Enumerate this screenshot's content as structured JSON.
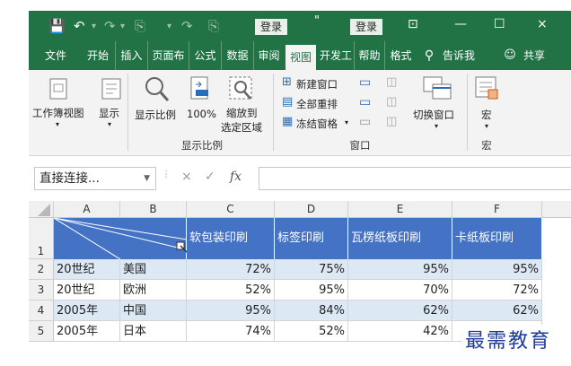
{
  "titlebar": {
    "login_1": "登录",
    "login_2": "登录",
    "title_mark": "\"",
    "minimize": "—",
    "restore": "☐",
    "close": "×"
  },
  "tabs": [
    {
      "label": "文件"
    },
    {
      "label": "开始"
    },
    {
      "label": "插入"
    },
    {
      "label": "页面布"
    },
    {
      "label": "公式"
    },
    {
      "label": "数据"
    },
    {
      "label": "审阅"
    },
    {
      "label": "视图",
      "active": true
    },
    {
      "label": "开发工"
    },
    {
      "label": "帮助"
    },
    {
      "label": "格式"
    },
    {
      "label": "告诉我"
    },
    {
      "label": "共享"
    }
  ],
  "ribbon": {
    "workbook_view": "工作簿视图",
    "show": "显示",
    "zoom": "显示比例",
    "zoom100": "100%",
    "zoom_selection_1": "缩放到",
    "zoom_selection_2": "选定区域",
    "new_window": "新建窗口",
    "arrange_all": "全部重排",
    "freeze_panes": "冻结窗格",
    "switch_windows": "切换窗口",
    "macro": "宏",
    "group_zoom": "显示比例",
    "group_window": "窗口",
    "group_macro": "宏"
  },
  "formula_bar": {
    "name_box": "直接连接...",
    "cancel": "×",
    "enter": "✓",
    "fx": "fx"
  },
  "columns": [
    "A",
    "B",
    "C",
    "D",
    "E",
    "F"
  ],
  "header_row": {
    "row_num": "1",
    "cells": [
      "软包装印刷",
      "标签印刷",
      "瓦楞纸板印刷",
      "卡纸板印刷"
    ]
  },
  "rows": [
    {
      "row": "2",
      "a": "20世纪",
      "b": "美国",
      "c": "72%",
      "d": "75%",
      "e": "95%",
      "f": "95%"
    },
    {
      "row": "3",
      "a": "20世纪",
      "b": "欧洲",
      "c": "52%",
      "d": "95%",
      "e": "70%",
      "f": "72%"
    },
    {
      "row": "4",
      "a": "2005年",
      "b": "中国",
      "c": "95%",
      "d": "84%",
      "e": "62%",
      "f": "62%"
    },
    {
      "row": "5",
      "a": "2005年",
      "b": "日本",
      "c": "74%",
      "d": "52%",
      "e": "42%",
      "f": ""
    }
  ],
  "watermark": "最需教育",
  "colors": {
    "excel_green": "#217346",
    "header_blue": "#4472c4",
    "band": "#dde8f5"
  }
}
